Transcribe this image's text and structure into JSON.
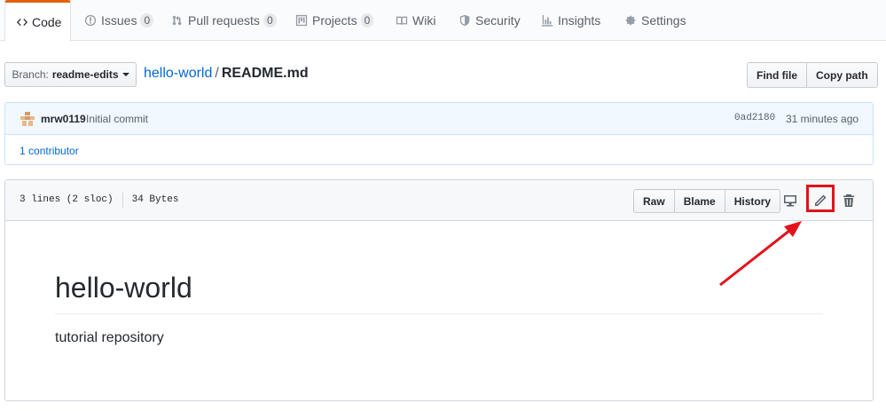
{
  "tabs": [
    {
      "label": "Code",
      "icon": "code-icon"
    },
    {
      "label": "Issues",
      "count": "0",
      "icon": "issue-icon"
    },
    {
      "label": "Pull requests",
      "count": "0",
      "icon": "pull-request-icon"
    },
    {
      "label": "Projects",
      "count": "0",
      "icon": "project-icon"
    },
    {
      "label": "Wiki",
      "icon": "book-icon"
    },
    {
      "label": "Security",
      "icon": "shield-icon"
    },
    {
      "label": "Insights",
      "icon": "graph-icon"
    },
    {
      "label": "Settings",
      "icon": "gear-icon"
    }
  ],
  "branch": {
    "prefix": "Branch:",
    "name": "readme-edits"
  },
  "breadcrumb": {
    "repo": "hello-world",
    "separator": "/",
    "file": "README.md"
  },
  "file_actions": {
    "find_file": "Find file",
    "copy_path": "Copy path"
  },
  "commit": {
    "author": "mrw0119",
    "message": "Initial commit",
    "sha": "0ad2180",
    "time": "31 minutes ago"
  },
  "contributors": {
    "count": "1",
    "label": "contributor"
  },
  "file": {
    "lines": "3 lines (2 sloc)",
    "size": "34 Bytes",
    "buttons": {
      "raw": "Raw",
      "blame": "Blame",
      "history": "History"
    },
    "icons": [
      "desktop-icon",
      "pencil-icon",
      "trash-icon"
    ]
  },
  "readme": {
    "heading": "hello-world",
    "body": "tutorial repository"
  },
  "colors": {
    "accent": "#e36209",
    "link": "#0366d6",
    "annotation": "#e2121b"
  }
}
